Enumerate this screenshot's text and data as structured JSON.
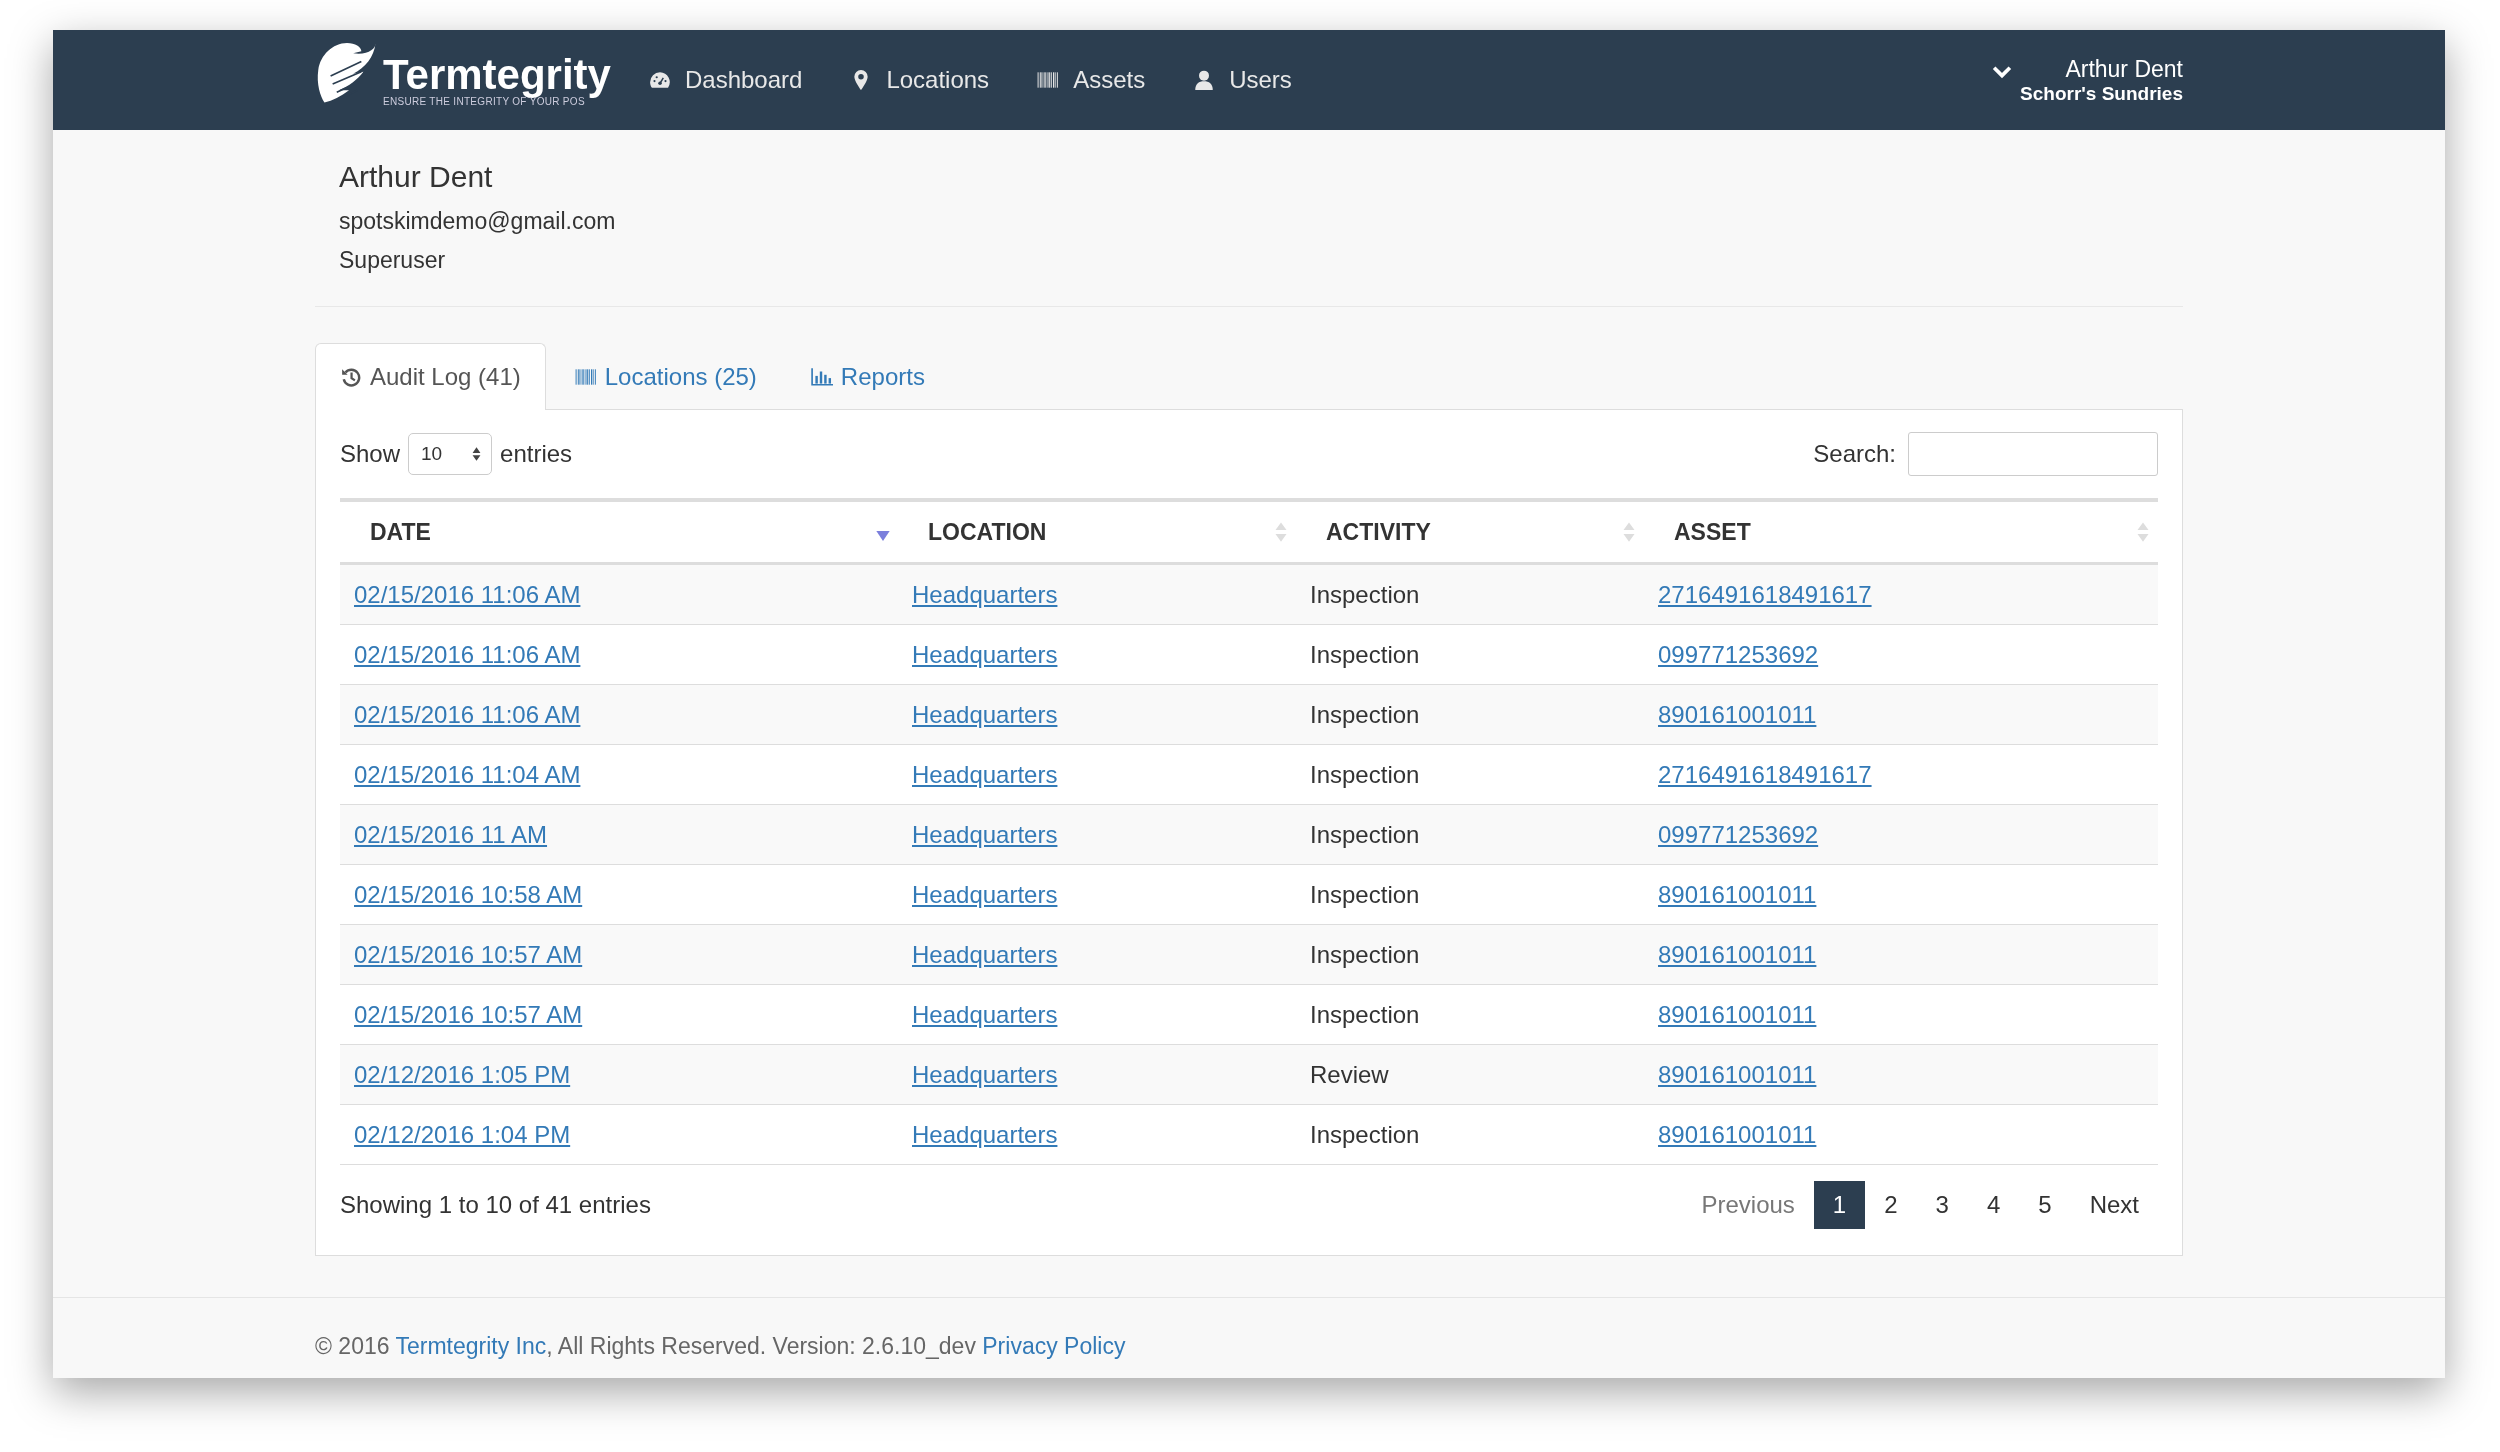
{
  "navbar": {
    "brand": {
      "name": "Termtegrity",
      "tagline": "ENSURE THE INTEGRITY OF YOUR POS"
    },
    "items": [
      {
        "label": "Dashboard"
      },
      {
        "label": "Locations"
      },
      {
        "label": "Assets"
      },
      {
        "label": "Users"
      }
    ],
    "user": {
      "name": "Arthur Dent",
      "company": "Schorr's Sundries"
    }
  },
  "profile": {
    "name": "Arthur Dent",
    "email": "spotskimdemo@gmail.com",
    "role": "Superuser"
  },
  "tabs": [
    {
      "label": "Audit Log (41)",
      "selected": true
    },
    {
      "label": "Locations (25)",
      "selected": false
    },
    {
      "label": "Reports",
      "selected": false
    }
  ],
  "length_control": {
    "label_before": "Show",
    "value": "10",
    "label_after": "entries"
  },
  "search": {
    "label": "Search:"
  },
  "table": {
    "columns": [
      {
        "label": "DATE",
        "sorted": true
      },
      {
        "label": "LOCATION",
        "sorted": false
      },
      {
        "label": "ACTIVITY",
        "sorted": false
      },
      {
        "label": "ASSET",
        "sorted": false
      }
    ],
    "rows": [
      {
        "date": "02/15/2016 11:06 AM",
        "location": "Headquarters",
        "activity": "Inspection",
        "asset": "2716491618491617"
      },
      {
        "date": "02/15/2016 11:06 AM",
        "location": "Headquarters",
        "activity": "Inspection",
        "asset": "099771253692"
      },
      {
        "date": "02/15/2016 11:06 AM",
        "location": "Headquarters",
        "activity": "Inspection",
        "asset": "890161001011"
      },
      {
        "date": "02/15/2016 11:04 AM",
        "location": "Headquarters",
        "activity": "Inspection",
        "asset": "2716491618491617"
      },
      {
        "date": "02/15/2016 11 AM",
        "location": "Headquarters",
        "activity": "Inspection",
        "asset": "099771253692"
      },
      {
        "date": "02/15/2016 10:58 AM",
        "location": "Headquarters",
        "activity": "Inspection",
        "asset": "890161001011"
      },
      {
        "date": "02/15/2016 10:57 AM",
        "location": "Headquarters",
        "activity": "Inspection",
        "asset": "890161001011"
      },
      {
        "date": "02/15/2016 10:57 AM",
        "location": "Headquarters",
        "activity": "Inspection",
        "asset": "890161001011"
      },
      {
        "date": "02/12/2016 1:05 PM",
        "location": "Headquarters",
        "activity": "Review",
        "asset": "890161001011"
      },
      {
        "date": "02/12/2016 1:04 PM",
        "location": "Headquarters",
        "activity": "Inspection",
        "asset": "890161001011"
      }
    ]
  },
  "info": "Showing 1 to 10 of 41 entries",
  "pagination": {
    "previous": {
      "label": "Previous",
      "disabled": true
    },
    "pages": [
      {
        "label": "1",
        "selected": true
      },
      {
        "label": "2",
        "selected": false
      },
      {
        "label": "3",
        "selected": false
      },
      {
        "label": "4",
        "selected": false
      },
      {
        "label": "5",
        "selected": false
      }
    ],
    "next": {
      "label": "Next",
      "disabled": false
    }
  },
  "footer": {
    "prefix": "© 2016 ",
    "company_link": "Termtegrity Inc",
    "middle": ", All Rights Reserved. Version: 2.6.10_dev ",
    "policy_link": "Privacy Policy"
  }
}
